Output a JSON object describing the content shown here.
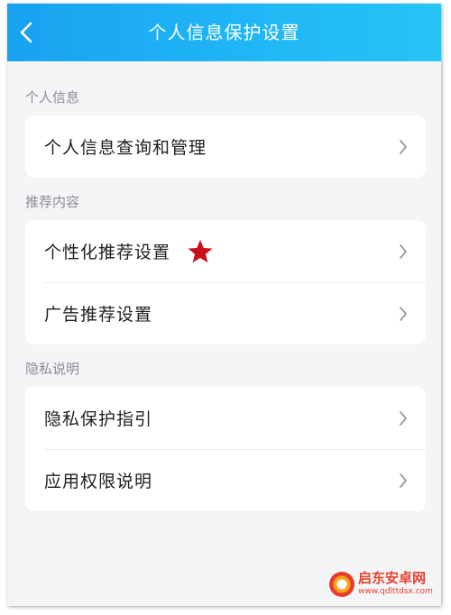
{
  "header": {
    "title": "个人信息保护设置",
    "back_icon": "chevron-left-icon",
    "background_color": "#1fb1f3"
  },
  "sections": [
    {
      "label": "个人信息",
      "items": [
        {
          "label": "个人信息查询和管理"
        }
      ]
    },
    {
      "label": "推荐内容",
      "items": [
        {
          "label": "个性化推荐设置",
          "badge_icon": "star-icon",
          "badge_color": "#c8101a"
        },
        {
          "label": "广告推荐设置"
        }
      ]
    },
    {
      "label": "隐私说明",
      "items": [
        {
          "label": "隐私保护指引"
        },
        {
          "label": "应用权限说明"
        }
      ]
    }
  ],
  "watermark": {
    "text": "启东安卓网",
    "url": "www.qdlttdsx.com"
  }
}
